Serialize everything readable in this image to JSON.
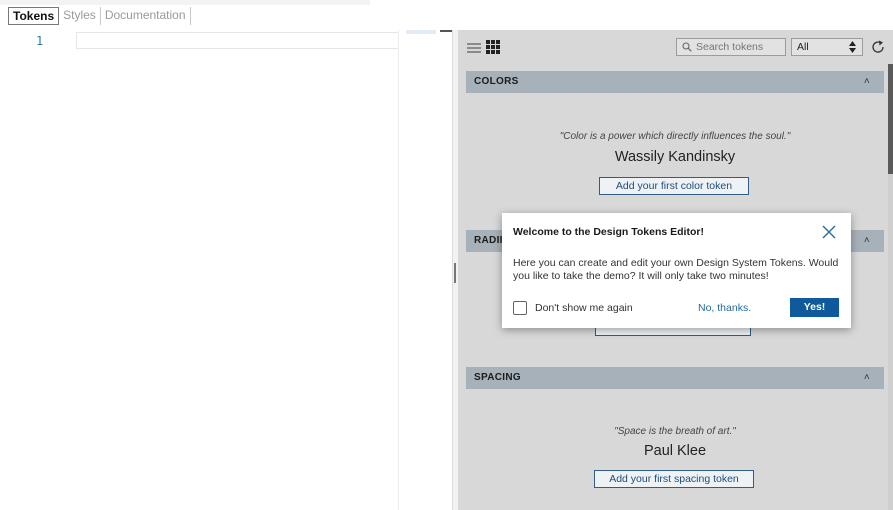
{
  "tabs": [
    {
      "label": "Tokens",
      "active": true
    },
    {
      "label": "Styles",
      "active": false
    },
    {
      "label": "Documentation",
      "active": false
    }
  ],
  "editor": {
    "line_number": "1"
  },
  "toolbar": {
    "list_view_icon": "list-icon",
    "grid_view_icon": "grid-icon",
    "search_placeholder": "Search tokens",
    "filter_value": "All",
    "refresh_icon": "refresh-icon"
  },
  "sections": {
    "colors": {
      "title": "COLORS",
      "quote": "\"Color is a power which directly influences the soul.\"",
      "author": "Wassily Kandinsky",
      "button": "Add your first color token"
    },
    "radii": {
      "title": "RADII"
    },
    "spacing": {
      "title": "SPACING",
      "quote": "\"Space is the breath of art.\"",
      "author": "Paul Klee",
      "button": "Add your first spacing token"
    }
  },
  "modal": {
    "title": "Welcome to the Design Tokens Editor!",
    "body": "Here you can create and edit your own Design System Tokens. Would you like to take the demo? It will only take two minutes!",
    "checkbox_label": "Don't show me again",
    "decline": "No, thanks.",
    "accept": "Yes!"
  },
  "colors": {
    "section_header_bg": "#a7b1b9",
    "panel_bg": "#d8d8d8",
    "primary_button": "#0f5a9c",
    "link": "#1f6aa5"
  }
}
